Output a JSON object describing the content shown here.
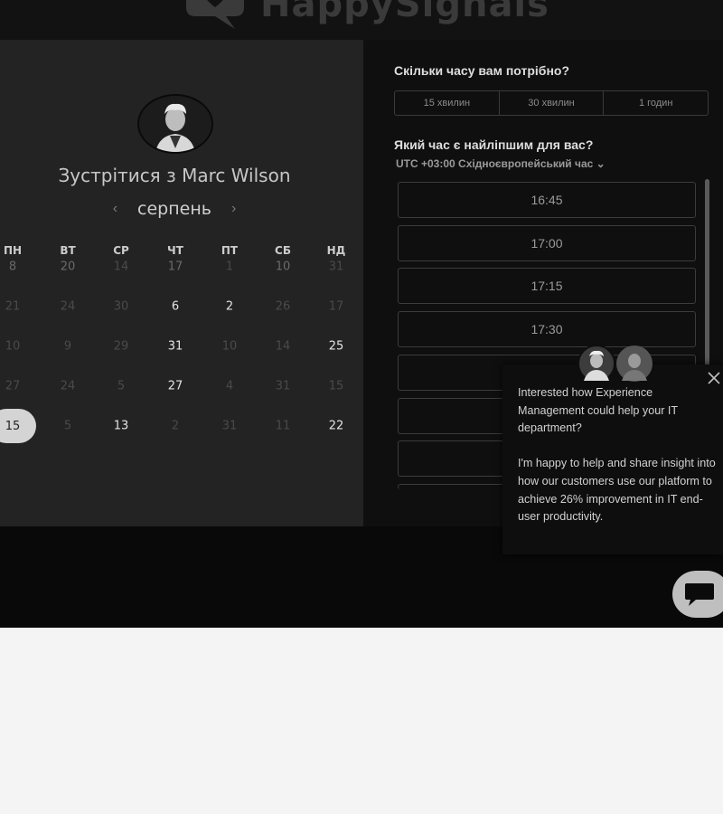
{
  "header": {
    "logo_text": "HappySignals",
    "logo_icon": "speech-heart-icon"
  },
  "calendar": {
    "meet_title": "Зустрітися з Marc Wilson",
    "month": "серпень",
    "prev_icon": "chevron-left-icon",
    "next_icon": "chevron-right-icon",
    "weekdays": [
      "ПН",
      "ВТ",
      "СР",
      "ЧТ",
      "ПТ",
      "СБ",
      "НД"
    ],
    "weeks": [
      [
        {
          "d": "8",
          "s": "mid"
        },
        {
          "d": "20",
          "s": "mid"
        },
        {
          "d": "14",
          "s": "dim"
        },
        {
          "d": "17",
          "s": "mid"
        },
        {
          "d": "1",
          "s": "dim"
        },
        {
          "d": "10",
          "s": "mid"
        },
        {
          "d": "31",
          "s": "dim"
        }
      ],
      [
        {
          "d": "21",
          "s": "dim"
        },
        {
          "d": "24",
          "s": "dim"
        },
        {
          "d": "30",
          "s": "dim"
        },
        {
          "d": "6",
          "s": "bright"
        },
        {
          "d": "2",
          "s": "bright"
        },
        {
          "d": "26",
          "s": "dim"
        },
        {
          "d": "17",
          "s": "dim"
        }
      ],
      [
        {
          "d": "10",
          "s": "dim"
        },
        {
          "d": "9",
          "s": "dim"
        },
        {
          "d": "29",
          "s": "dim"
        },
        {
          "d": "31",
          "s": "bright"
        },
        {
          "d": "10",
          "s": "dim"
        },
        {
          "d": "14",
          "s": "dim"
        },
        {
          "d": "25",
          "s": "bright"
        }
      ],
      [
        {
          "d": "27",
          "s": "dim"
        },
        {
          "d": "24",
          "s": "dim"
        },
        {
          "d": "5",
          "s": "dim"
        },
        {
          "d": "27",
          "s": "bright"
        },
        {
          "d": "4",
          "s": "dim"
        },
        {
          "d": "31",
          "s": "dim"
        },
        {
          "d": "15",
          "s": "dim"
        }
      ],
      [
        {
          "d": "15",
          "s": "selected"
        },
        {
          "d": "5",
          "s": "dim"
        },
        {
          "d": "13",
          "s": "bright"
        },
        {
          "d": "2",
          "s": "dim"
        },
        {
          "d": "31",
          "s": "dim"
        },
        {
          "d": "11",
          "s": "dim"
        },
        {
          "d": "22",
          "s": "bright"
        }
      ]
    ]
  },
  "booking": {
    "duration_question": "Скільки часу вам потрібно?",
    "durations": [
      "15 хвилин",
      "30 хвилин",
      "1 годин"
    ],
    "time_question": "Який час є найліпшим для вас?",
    "timezone": "UTC +03:00 Східноєвропейський час ⌄",
    "slots": [
      "16:45",
      "17:00",
      "17:15",
      "17:30",
      "",
      "",
      "",
      ""
    ]
  },
  "chat_popup": {
    "paragraph1": "Interested how Experience Management could help your IT department?",
    "paragraph2": "I'm happy to help and share insight into how our customers use our platform to achieve 26% improvement in IT end-user productivity.",
    "close_icon": "close-icon",
    "launcher_icon": "chat-bubble-icon"
  },
  "colors": {
    "background": "#0b0b0b",
    "panel_left": "#232323",
    "panel_right": "#0f0f0f",
    "page_below": "#f4f4f4"
  }
}
